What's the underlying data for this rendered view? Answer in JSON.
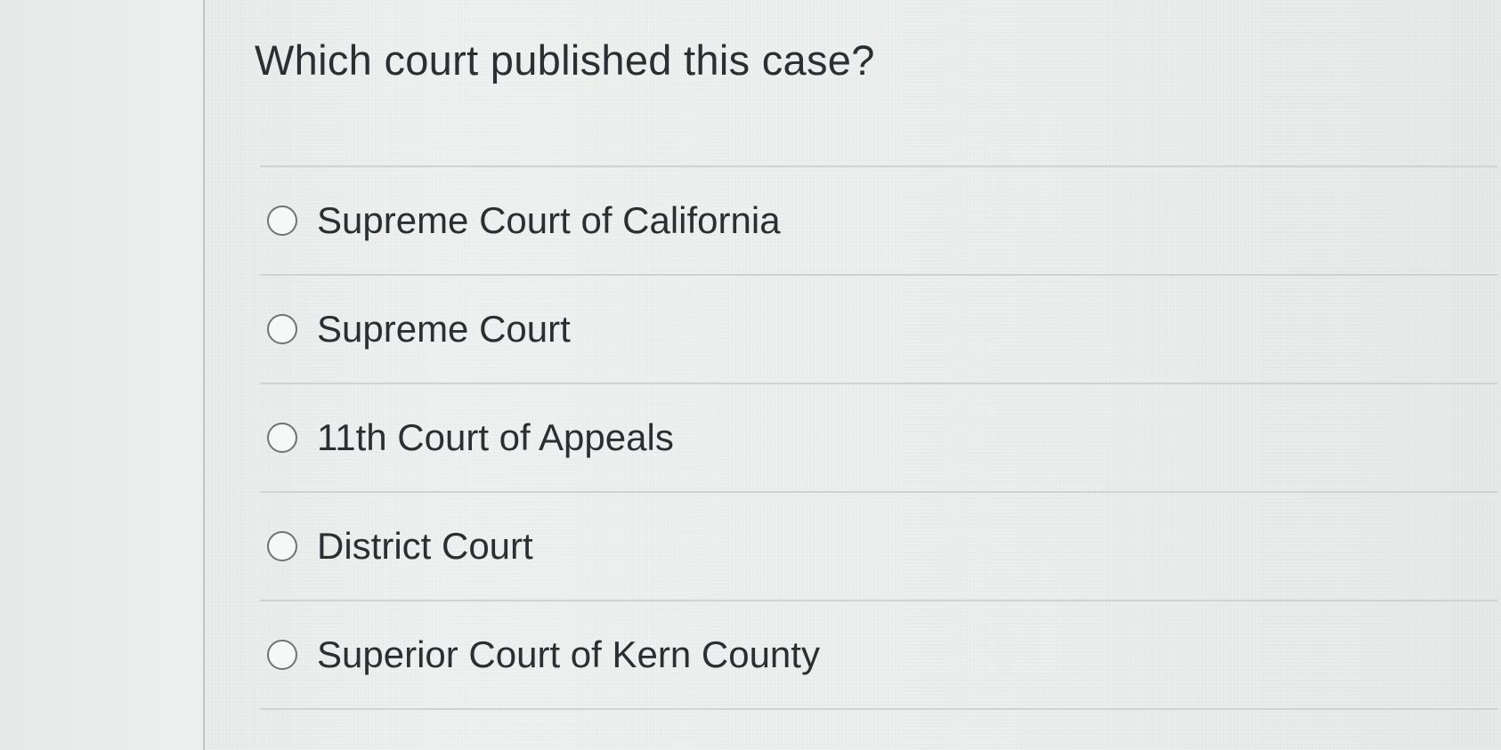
{
  "question": {
    "text": "Which court published this case?"
  },
  "answers": [
    {
      "label": "Supreme Court of California",
      "selected": false
    },
    {
      "label": "Supreme Court",
      "selected": false
    },
    {
      "label": "11th Court of Appeals",
      "selected": false
    },
    {
      "label": "District Court",
      "selected": false
    },
    {
      "label": "Superior Court of Kern County",
      "selected": false
    }
  ],
  "colors": {
    "text": "#2b2f31",
    "radio_border": "#6f7375",
    "separator": "#cfd3d2",
    "background": "#e9eaea"
  }
}
